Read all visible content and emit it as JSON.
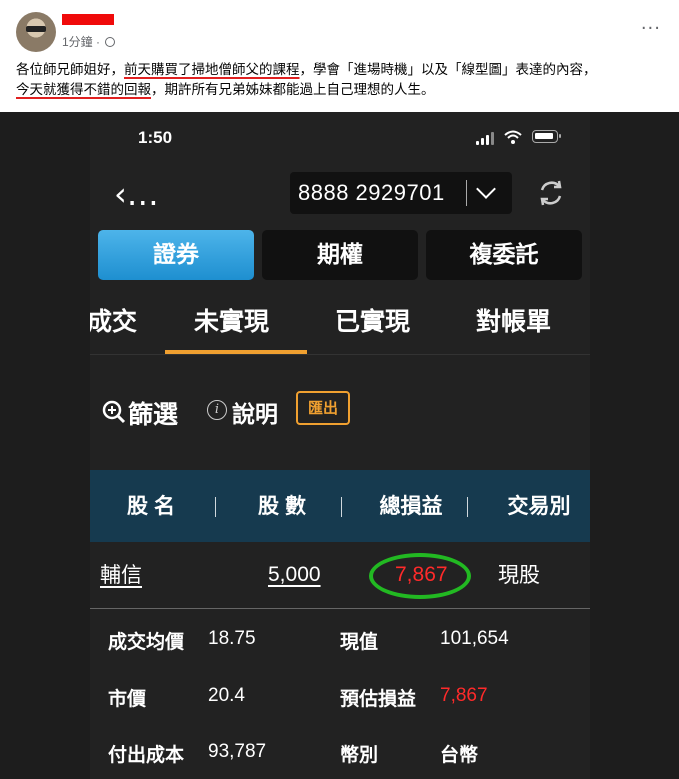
{
  "post": {
    "time": "1分鐘",
    "text_1": "各位師兄師姐好，",
    "text_2": "前天購買了掃地僧師父的課程",
    "text_3": "，學會「進場時機」以及「線型圖」表達的內容，",
    "text_4": "今天就獲得不錯的回報",
    "text_5": "，期許所有兄弟姊妹都能過上自己理想的人生。",
    "more_icon": "more-horizontal-icon"
  },
  "status": {
    "time": "1:50"
  },
  "nav": {
    "back": "‹…",
    "account": "8888 2929701"
  },
  "segments": [
    "證券",
    "期權",
    "複委託"
  ],
  "tabs": [
    "成交",
    "未實現",
    "已實現",
    "對帳單"
  ],
  "filter": {
    "filter_label": "篩選",
    "help_label": "說明",
    "export_label": "匯出"
  },
  "table": {
    "headers": [
      "股名",
      "股數",
      "總損益",
      "交易別"
    ],
    "row": {
      "name": "輔信",
      "shares": "5,000",
      "pnl": "7,867",
      "type": "現股"
    }
  },
  "details": {
    "avg_price_label": "成交均價",
    "avg_price": "18.75",
    "present_value_label": "現值",
    "present_value": "101,654",
    "market_price_label": "市價",
    "market_price": "20.4",
    "est_pnl_label": "預估損益",
    "est_pnl": "7,867",
    "cost_label": "付出成本",
    "cost": "93,787",
    "currency_label": "幣別",
    "currency": "台幣"
  },
  "colors": {
    "accent": "#f0a030",
    "profit": "#ff2a2a",
    "header_bg": "#163a4f",
    "circle": "#22b922",
    "redline": "#e02020"
  }
}
